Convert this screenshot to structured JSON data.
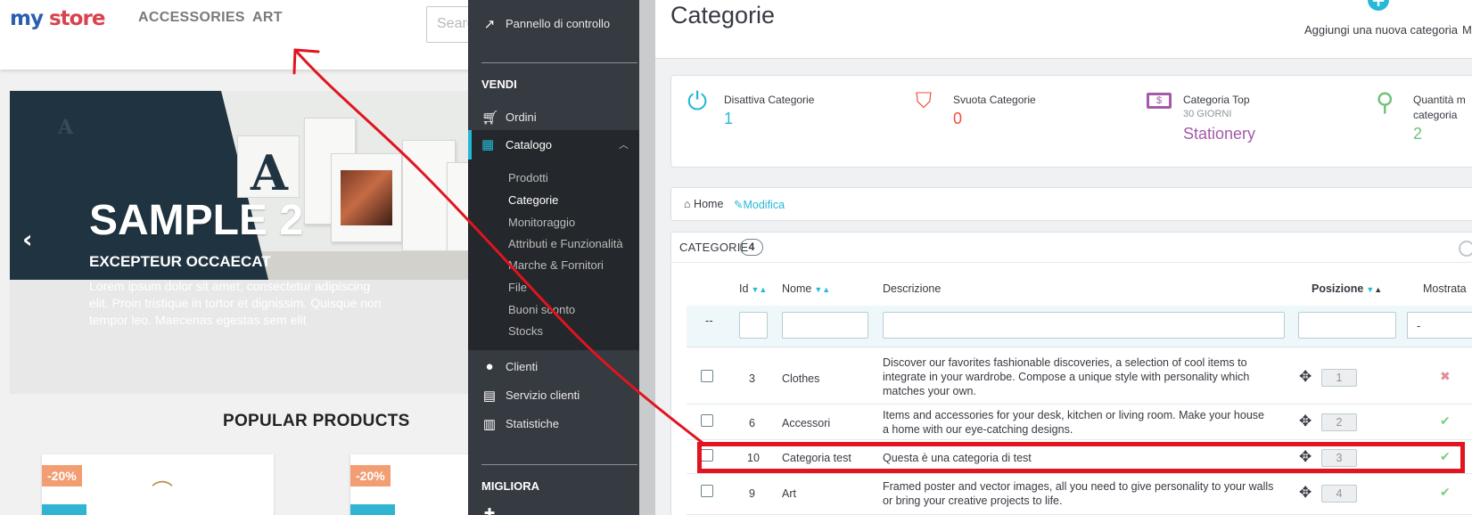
{
  "store": {
    "logo_my": "my",
    "logo_store": "store",
    "nav": [
      "ACCESSORIES",
      "ART"
    ],
    "search_placeholder": "Searc",
    "slider": {
      "title": "SAMPLE 2",
      "subtitle": "EXCEPTEUR OCCAECAT",
      "text": "Lorem ipsum dolor sit amet, consectetur adipiscing elit. Proin tristique in tortor et dignissim. Quisque non tempor leo. Maecenas egestas sem elit",
      "prev": "‹"
    },
    "popular_title": "POPULAR PRODUCTS",
    "discounts": [
      "-20%",
      "-20%"
    ]
  },
  "sidebar": {
    "dashboard": "Pannello di controllo",
    "section_sell": "VENDI",
    "orders": "Ordini",
    "catalog": "Catalogo",
    "catalog_sub": [
      "Prodotti",
      "Categorie",
      "Monitoraggio",
      "Attributi e Funzionalità",
      "Marche & Fornitori",
      "File",
      "Buoni sconto",
      "Stocks"
    ],
    "customers": "Clienti",
    "customer_service": "Servizio clienti",
    "stats": "Statistiche",
    "section_improve": "MIGLIORA"
  },
  "header": {
    "title": "Categorie",
    "add_label": "Aggiungi una nuova categoria",
    "more_label": "M"
  },
  "kpi": [
    {
      "label": "Disattiva Categorie",
      "value": "1",
      "color": "#25b9d7",
      "icon": "power-icon"
    },
    {
      "label": "Svuota Categorie",
      "value": "0",
      "color": "#f54c3e",
      "icon": "bookmark-icon"
    },
    {
      "label": "Categoria Top",
      "sub": "30 GIORNI",
      "value": "Stationery",
      "color": "#a45aa8",
      "icon": "money-icon"
    },
    {
      "label": "Quantità m",
      "label2": "categoria",
      "value": "2",
      "color": "#72c279",
      "icon": "search-icon"
    }
  ],
  "breadcrumb": {
    "home": "Home",
    "edit": "Modifica"
  },
  "table": {
    "title": "CATEGORIE",
    "count": "4",
    "columns": {
      "id": "Id",
      "name": "Nome",
      "description": "Descrizione",
      "position": "Posizione",
      "shown": "Mostrata"
    },
    "filter_dash": "--",
    "filter_select": "-",
    "rows": [
      {
        "id": "3",
        "name": "Clothes",
        "description": "Discover our favorites fashionable discoveries, a selection of cool items to integrate in your wardrobe. Compose a unique style with personality which matches your own.",
        "position": "1",
        "shown": false
      },
      {
        "id": "6",
        "name": "Accessori",
        "description": "Items and accessories for your desk, kitchen or living room. Make your house a home with our eye-catching designs.",
        "position": "2",
        "shown": true
      },
      {
        "id": "10",
        "name": "Categoria test",
        "description": "Questa è una categoria di test",
        "position": "3",
        "shown": true
      },
      {
        "id": "9",
        "name": "Art",
        "description": "Framed poster and vector images, all you need to give personality to your walls or bring your creative projects to life.",
        "position": "4",
        "shown": true
      }
    ]
  },
  "colors": {
    "accent": "#25b9d7",
    "annotation": "#e1141f",
    "check": "#78d07d",
    "cross": "#e08f95"
  }
}
